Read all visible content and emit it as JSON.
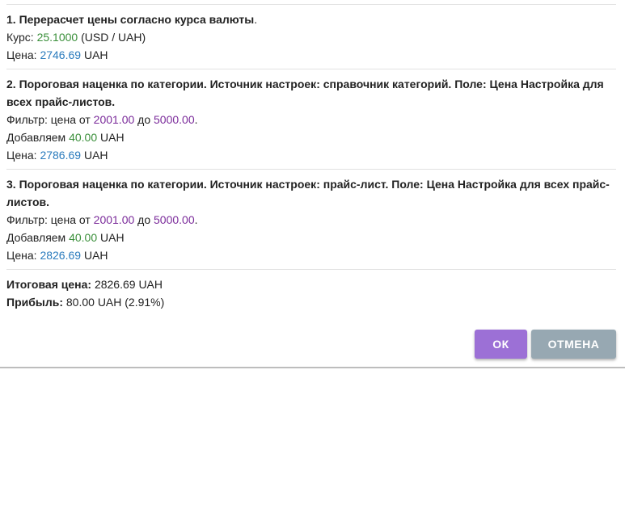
{
  "sections": [
    {
      "title": "1. Перерасчет цены согласно курса валюты",
      "title_suffix": ".",
      "rate_label": "Курс: ",
      "rate_value": "25.1000",
      "rate_pair": " (USD / UAH)",
      "price_label": "Цена: ",
      "price_value": "2746.69",
      "price_currency": " UAH"
    },
    {
      "title": "2. Пороговая наценка по категории. Источник настроек: справочник категорий. Поле: Цена Настройка для всех прайс-листов.",
      "filter_label": "Фильтр: цена от ",
      "filter_from": "2001.00",
      "filter_to_word": " до ",
      "filter_to": "5000.00",
      "filter_end": ".",
      "add_label": "Добавляем ",
      "add_value": "40.00",
      "add_currency": " UAH",
      "price_label": "Цена: ",
      "price_value": "2786.69",
      "price_currency": " UAH"
    },
    {
      "title": "3. Пороговая наценка по категории. Источник настроек: прайс-лист. Поле: Цена Настройка для всех прайс-листов.",
      "filter_label": "Фильтр: цена от ",
      "filter_from": "2001.00",
      "filter_to_word": " до ",
      "filter_to": "5000.00",
      "filter_end": ".",
      "add_label": "Добавляем ",
      "add_value": "40.00",
      "add_currency": " UAH",
      "price_label": "Цена: ",
      "price_value": "2826.69",
      "price_currency": " UAH"
    }
  ],
  "totals": {
    "final_label": "Итоговая цена:",
    "final_value": " 2826.69 UAH",
    "profit_label": "Прибыль:",
    "profit_value": " 80.00 UAH (2.91%)"
  },
  "buttons": {
    "ok_label": "ОК",
    "cancel_label": "ОТМЕНА"
  },
  "colors": {
    "rate": "#3a8f3a",
    "price": "#2a7bbd",
    "filter": "#7a2a9a",
    "ok_button": "#9c70d6",
    "cancel_button": "#97a8b2"
  }
}
